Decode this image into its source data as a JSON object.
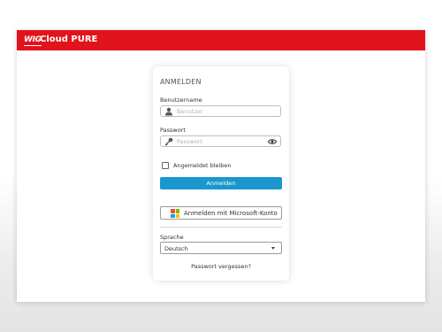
{
  "header": {
    "brand_mark": "WIG",
    "brand_name": "Cloud PURE",
    "color": "#e1131c"
  },
  "login": {
    "title": "ANMELDEN",
    "username_label": "Benutzername",
    "username_placeholder": "Benutzer",
    "password_label": "Passwort",
    "password_placeholder": "Passwort",
    "remember_label": "Angemeldet bleiben",
    "remember_checked": false,
    "submit_label": "Anmelden",
    "submit_color": "#1a97cd",
    "microsoft_label": "Anmelden mit Microsoft-Konto",
    "language_label": "Sprache",
    "language_value": "Deutsch",
    "forgot_label": "Passwort vergessen?"
  },
  "icons": {
    "user": "user-icon",
    "key": "key-icon",
    "eye": "eye-icon",
    "microsoft": "microsoft-logo-icon",
    "caret": "chevron-down-icon"
  }
}
